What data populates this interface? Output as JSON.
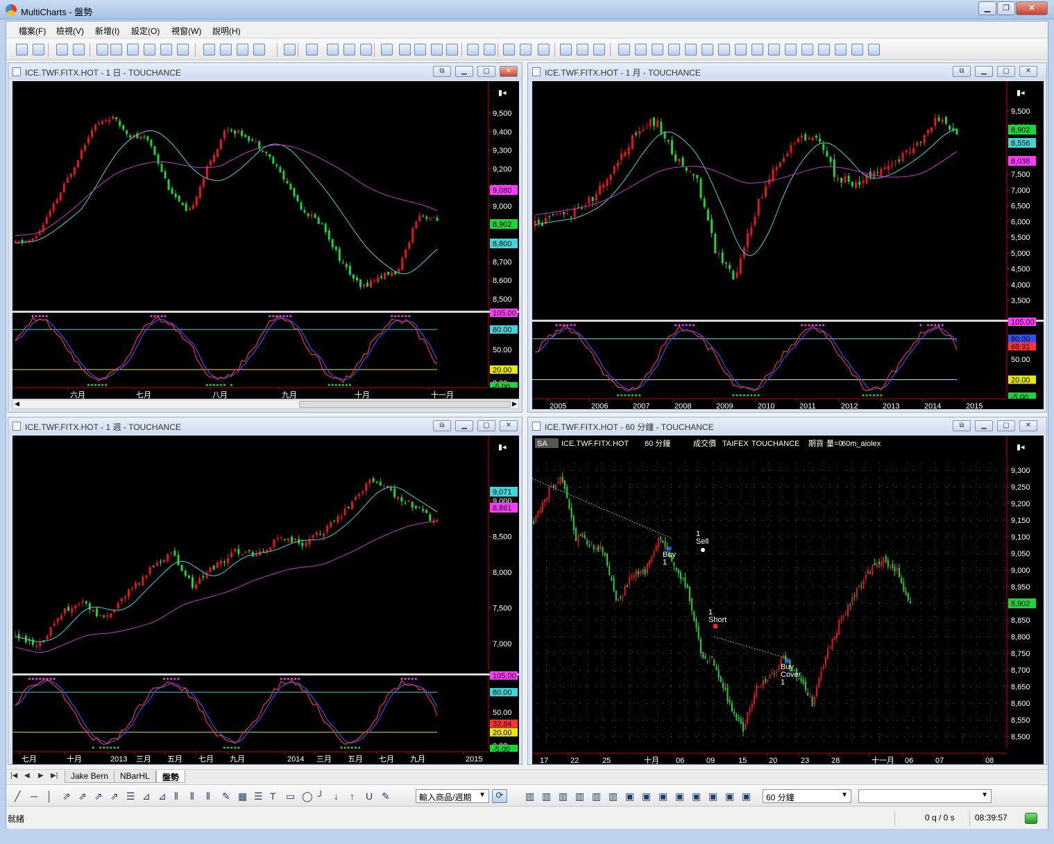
{
  "app": {
    "title": "MultiCharts - 盤勢",
    "menu": [
      "檔案(F)",
      "檢視(V)",
      "新增(I)",
      "設定(O)",
      "視窗(W)",
      "說明(H)"
    ]
  },
  "colors": {
    "bg": "#000000",
    "bull": "#e8161b",
    "bear": "#19d63b",
    "ma_fast": "#3fd6d9",
    "ma_slow": "#c736c8",
    "kd_k": "#ff3030",
    "kd_d": "#2f52ff",
    "upper_line": "#3fd6d9",
    "lower_line": "#e8e800",
    "dots_top": "#ff39ff",
    "dots_bottom": "#19d63b"
  },
  "windows": {
    "daily": {
      "title": "ICE.TWF.FITX.HOT - 1 日 - TOUCHANCE",
      "y_ticks": [
        "9,500",
        "9,400",
        "9,300",
        "9,200",
        "9,100",
        "9,000",
        "8,900",
        "8,800",
        "8,700",
        "8,600",
        "8,500"
      ],
      "badges": [
        {
          "text": "9,080",
          "color": "#ff39ff"
        },
        {
          "text": "8,902",
          "color": "#19d63b"
        },
        {
          "text": "8,800",
          "color": "#3fd6d9"
        }
      ],
      "ind_ticks": [
        "105.00",
        "80.00",
        "50.00",
        "20.00",
        "0.00",
        "-5.00"
      ],
      "x_ticks": [
        "六月",
        "七月",
        "八月",
        "九月",
        "十月",
        "十一月"
      ]
    },
    "monthly": {
      "title": "ICE.TWF.FITX.HOT - 1 月 - TOUCHANCE",
      "y_ticks": [
        "9,500",
        "9,000",
        "8,500",
        "8,000",
        "7,500",
        "7,000",
        "6,500",
        "6,000",
        "5,500",
        "5,000",
        "4,500",
        "4,000",
        "3,500"
      ],
      "badges": [
        {
          "text": "8,902",
          "color": "#19d63b"
        },
        {
          "text": "8,556",
          "color": "#3fd6d9"
        },
        {
          "text": "8,038",
          "color": "#ff39ff"
        }
      ],
      "ind_ticks": [
        "105.00",
        "80.00",
        "50.00",
        "20.00",
        "-5.00"
      ],
      "ind_badges": [
        {
          "text": "80.00",
          "color": "#2f52ff"
        },
        {
          "text": "68.91",
          "color": "#ff3030"
        }
      ],
      "x_ticks": [
        "2005",
        "2006",
        "2007",
        "2008",
        "2009",
        "2010",
        "2011",
        "2012",
        "2013",
        "2014",
        "2015"
      ]
    },
    "weekly": {
      "title": "ICE.TWF.FITX.HOT - 1 週 - TOUCHANCE",
      "y_ticks": [
        "9,000",
        "8,500",
        "8,000",
        "7,500",
        "7,000"
      ],
      "badges": [
        {
          "text": "9,071",
          "color": "#3fd6d9"
        },
        {
          "text": "8,861",
          "color": "#ff39ff"
        }
      ],
      "ind_ticks": [
        "105.00",
        "80.00",
        "50.00",
        "20.00",
        "0.00",
        "-5.00"
      ],
      "ind_badges": [
        {
          "text": "32.84",
          "color": "#ff3030"
        }
      ],
      "x_ticks": [
        "七月",
        "十月",
        "2013",
        "三月",
        "五月",
        "七月",
        "九月",
        "2014",
        "三月",
        "五月",
        "七月",
        "九月",
        "2015"
      ]
    },
    "hourly": {
      "title": "ICE.TWF.FITX.HOT - 60 分鐘 - TOUCHANCE",
      "info": {
        "sa": "SA",
        "symbol": "ICE.TWF.FITX.HOT",
        "interval": "60 分鐘",
        "price": "成交價",
        "exchange": "TAIFEX",
        "source": "TOUCHANCE",
        "type": "期貨",
        "volume": "量=0",
        "strategy": "60m_aiolex"
      },
      "y_ticks": [
        "9,300",
        "9,250",
        "9,200",
        "9,150",
        "9,100",
        "9,050",
        "9,000",
        "8,950",
        "8,900",
        "8,850",
        "8,800",
        "8,750",
        "8,700",
        "8,650",
        "8,600",
        "8,550",
        "8,500"
      ],
      "badges": [
        {
          "text": "8,902",
          "color": "#19d63b"
        }
      ],
      "x_ticks": [
        "17",
        "22",
        "25",
        "十月",
        "06",
        "09",
        "15",
        "20",
        "23",
        "28",
        "十一月",
        "06",
        "07",
        "08"
      ],
      "signals": [
        {
          "label": "Buy",
          "qty": "1"
        },
        {
          "label": "Sell",
          "qty": "1"
        },
        {
          "label": "Short",
          "qty": "1"
        },
        {
          "label": "Buy",
          "label2": "Cover",
          "qty": "1"
        }
      ]
    }
  },
  "tabs": [
    "Jake Bern",
    "NBarHL",
    "盤勢"
  ],
  "drawbar": {
    "symbol_combo": "輸入商品/週期",
    "interval_combo": "60 分鐘"
  },
  "status": {
    "left": "就緒",
    "quotes": "0 q / 0 s",
    "time": "08:39:57"
  }
}
